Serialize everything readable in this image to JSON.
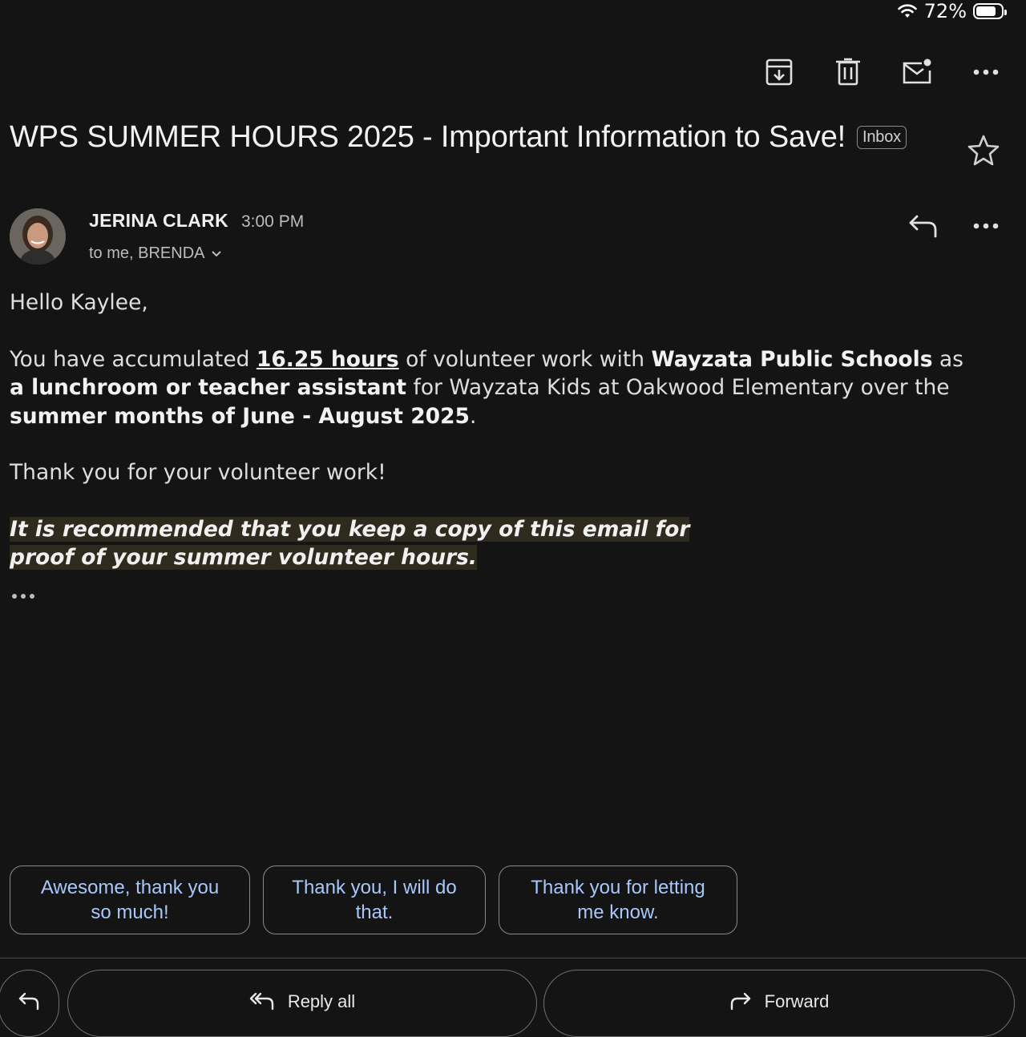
{
  "status_bar": {
    "battery_percent": "72%",
    "battery_level": 0.72
  },
  "toolbar": {
    "archive": "archive-icon",
    "delete": "trash-icon",
    "mark_unread": "mail-unread-icon",
    "more": "more-horizontal-icon"
  },
  "email": {
    "subject": "WPS SUMMER HOURS 2025 - Important Information to Save!",
    "label": "Inbox",
    "sender": "JERINA CLARK",
    "time": "3:00 PM",
    "recipients": "to me, BRENDA",
    "greeting": "Hello Kaylee,",
    "body": {
      "p1_a": "You have accumulated ",
      "p1_hours": "16.25 hours",
      "p1_b": " of volunteer work with ",
      "p1_org": "Wayzata Public Schools",
      "p1_c": " as ",
      "p1_role": "a lunchroom or teacher assistant",
      "p1_d": " for Wayzata Kids at Oakwood Elementary over the ",
      "p1_period": "summer months of June - August 2025",
      "p1_e": ".",
      "thanks": "Thank you for your volunteer work!",
      "recommendation": "It is recommended that you keep a copy of this email for proof of your summer volunteer hours."
    }
  },
  "smart_replies": [
    "Awesome, thank you so much!",
    "Thank you, I will do that.",
    "Thank you for letting me know."
  ],
  "actions": {
    "reply_all": "Reply all",
    "forward": "Forward"
  }
}
